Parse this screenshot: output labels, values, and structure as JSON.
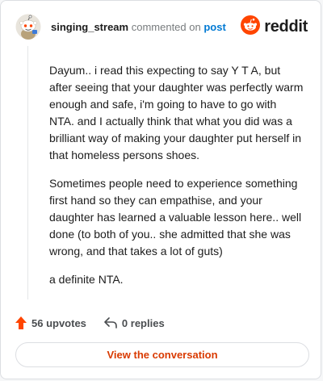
{
  "comment": {
    "username": "singing_stream",
    "action_text": "commented on",
    "post_link": "post",
    "paragraphs": [
      "Dayum.. i read this expecting to say Y T A, but after seeing that your daughter was perfectly warm enough and safe, i'm going to have to go with NTA. and I actually think that what you did was a brilliant way of making your daughter put herself in that homeless persons shoes.",
      "Sometimes people need to experience something first hand so they can empathise, and your daughter has learned a valuable lesson here.. well done (to both of you.. she admitted that she was wrong, and that takes a lot of guts)",
      "a definite NTA."
    ]
  },
  "brand": {
    "name": "reddit",
    "color": "#ff4500",
    "icon": "reddit-logo-icon"
  },
  "stats": {
    "upvotes": "56 upvotes",
    "replies": "0 replies",
    "upvote_icon": "upvote-arrow-icon",
    "reply_icon": "reply-arrow-icon",
    "upvote_color": "#ff4500"
  },
  "cta": {
    "label": "View the conversation",
    "color": "#d93a00"
  }
}
